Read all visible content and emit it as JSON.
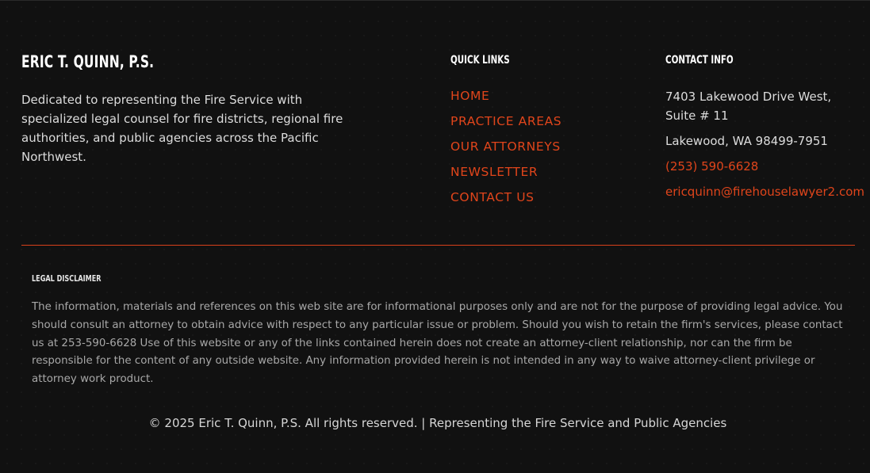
{
  "brand": {
    "title": "ERIC T. QUINN, P.S.",
    "description": "Dedicated to representing the Fire Service with specialized legal counsel for fire districts, regional fire authorities, and public agencies across the Pacific Northwest."
  },
  "quick_links": {
    "heading": "QUICK LINKS",
    "items": [
      {
        "label": "HOME"
      },
      {
        "label": "PRACTICE AREAS"
      },
      {
        "label": "OUR ATTORNEYS"
      },
      {
        "label": "NEWSLETTER"
      },
      {
        "label": "CONTACT US"
      }
    ]
  },
  "contact": {
    "heading": "CONTACT INFO",
    "address_line1": "7403 Lakewood Drive West,",
    "address_line2": "Suite # 11",
    "city": "Lakewood, WA 98499-7951",
    "phone": "(253) 590-6628",
    "email": "ericquinn@firehouselawyer2.com"
  },
  "disclaimer": {
    "heading": "LEGAL DISCLAIMER",
    "text": "The information, materials and references on this web site are for informational purposes only and are not for the purpose of providing legal advice. You should consult an attorney to obtain advice with respect to any particular issue or problem. Should you wish to retain the firm's services, please contact us at 253-590-6628 Use of this website or any of the links contained herein does not create an attorney-client relationship, nor can the firm be responsible for the content of any outside website. Any information provided herein is not intended in any way to waive attorney-client privilege or attorney work product."
  },
  "footer": {
    "copyright": "© 2025 Eric T. Quinn, P.S. All rights reserved. | Representing the Fire Service and Public Agencies"
  },
  "colors": {
    "background": "#111111",
    "accent": "#e0451b",
    "text": "#dcdcdc",
    "muted_text": "#a8a8a8"
  }
}
